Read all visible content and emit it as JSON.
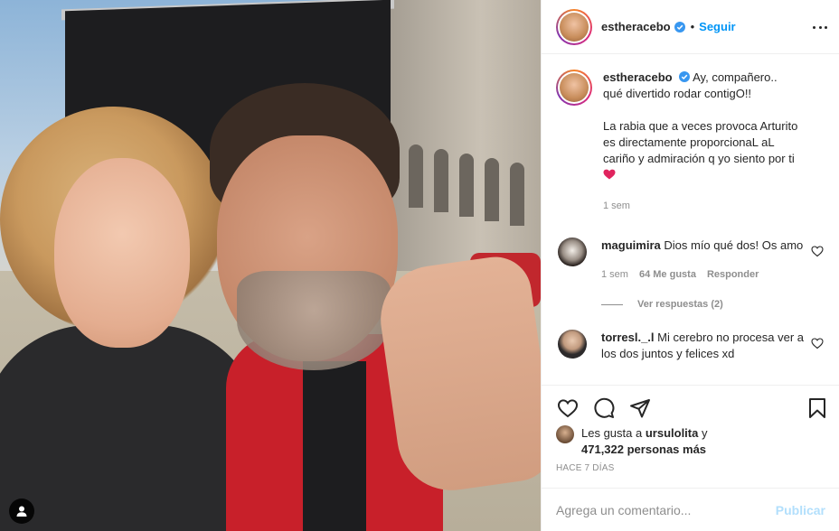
{
  "post": {
    "author": "estheracebo",
    "follow_label": "Seguir",
    "dot": "•",
    "caption_lines": [
      "Ay, compañero..",
      "qué divertido rodar contigO!!",
      "",
      "La rabia que a veces provoca Arturito",
      "es directamente proporcionaL aL",
      "cariño y admiración q yo siento por ti"
    ],
    "caption_time": "1 sem",
    "likes_prefix": "Les gusta a",
    "likes_user": "ursulolita",
    "likes_and": "y",
    "likes_count": "471,322 personas más",
    "date": "HACE 7 DÍAS"
  },
  "comments": [
    {
      "user": "maguimira",
      "text": "Dios mío qué dos! Os amo",
      "time": "1 sem",
      "likes": "64 Me gusta",
      "reply_label": "Responder",
      "view_replies": "Ver respuestas (2)"
    },
    {
      "user": "torresl._.l",
      "text": "Mi cerebro no procesa ver a los dos juntos y felices xd"
    }
  ],
  "composer": {
    "placeholder": "Agrega un comentario...",
    "post_label": "Publicar"
  },
  "colors": {
    "accent": "#0095f6",
    "muted": "#8e8e8e",
    "heart": "#ed4956"
  },
  "icons": [
    "verified-icon",
    "more-options-icon",
    "heart-icon",
    "comment-icon",
    "share-icon",
    "save-icon",
    "user-tag-icon"
  ]
}
